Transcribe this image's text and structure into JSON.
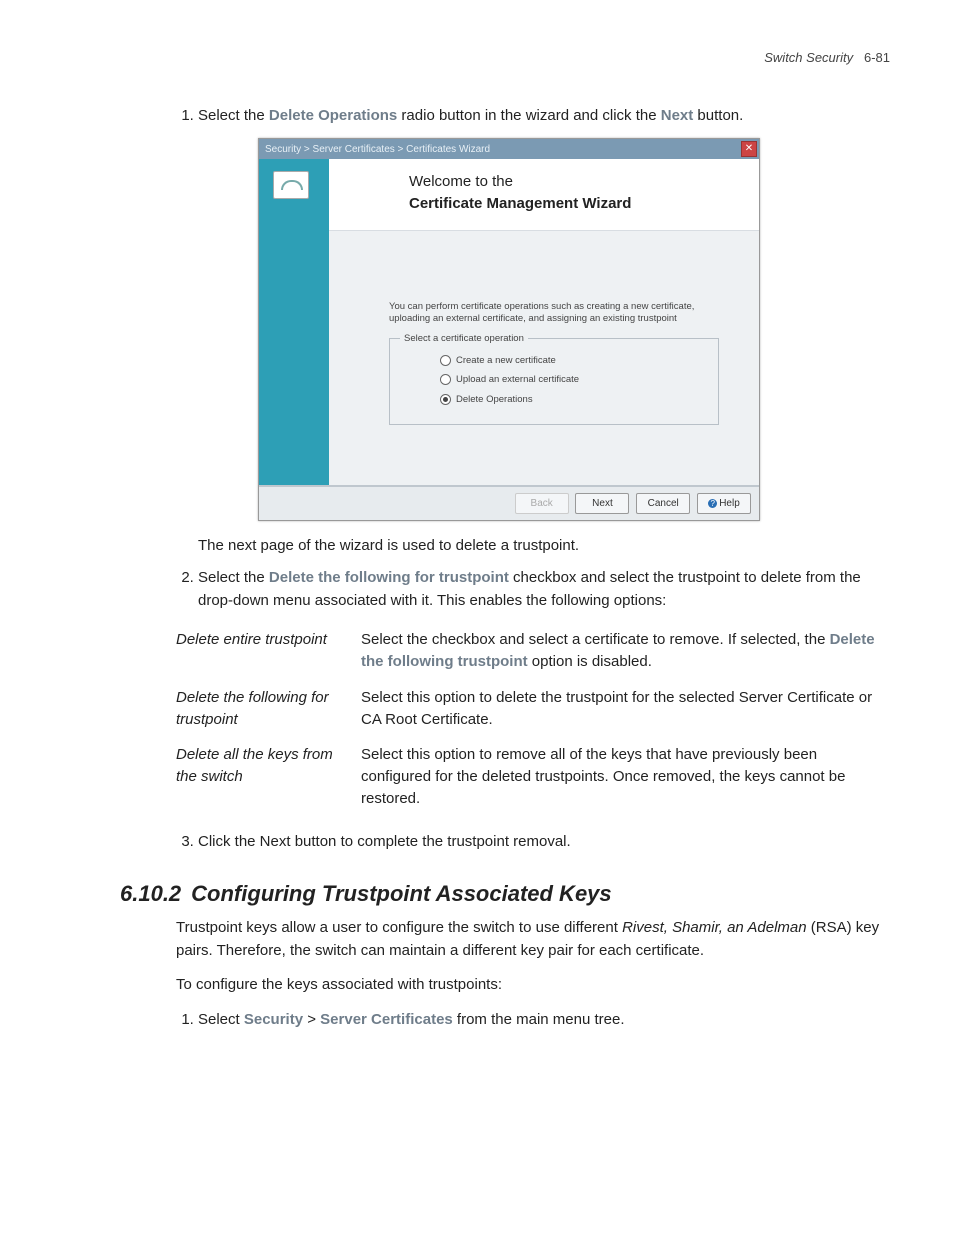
{
  "header": {
    "section": "Switch Security",
    "page": "6-81"
  },
  "step1": {
    "pre": "Select the ",
    "bold1": "Delete Operations",
    "mid": " radio button in the wizard and click the ",
    "bold2": "Next",
    "post": " button."
  },
  "wizard": {
    "titlebar": "Security > Server Certificates > Certificates Wizard",
    "heading_l1": "Welcome to the",
    "heading_l2": "Certificate Management Wizard",
    "desc": "You can perform certificate operations such as creating a new certificate, uploading an external certificate, and assigning an existing trustpoint",
    "legend": "Select a certificate operation",
    "opt1": "Create a new certificate",
    "opt2": "Upload an external certificate",
    "opt3": "Delete Operations",
    "btn_back": "Back",
    "btn_next": "Next",
    "btn_cancel": "Cancel",
    "btn_help": "Help"
  },
  "after_wizard": "The next page of the wizard is used to delete a trustpoint.",
  "step2": {
    "pre": "Select the ",
    "bold": "Delete the following for trustpoint",
    "post": " checkbox and select the trustpoint to delete from the drop-down menu associated with it. This enables the following options:"
  },
  "table": {
    "r1_term": "Delete entire trustpoint",
    "r1_desc_pre": "Select the checkbox and select a certificate to remove. If selected, the ",
    "r1_desc_bold": "Delete the following trustpoint",
    "r1_desc_post": " option is disabled.",
    "r2_term": "Delete the following for trustpoint",
    "r2_desc": "Select this option to delete the trustpoint for the selected Server Certificate or CA Root Certificate.",
    "r3_term": "Delete all the keys from the switch",
    "r3_desc": "Select this option to remove all of the keys that have previously been configured for the deleted trustpoints. Once removed, the keys cannot be restored."
  },
  "step3": "Click the Next button to complete the trustpoint removal.",
  "section": {
    "num": "6.10.2",
    "title": "Configuring Trustpoint Associated Keys",
    "p1_pre": "Trustpoint keys allow a user to configure the switch to use different ",
    "p1_it": "Rivest, Shamir, an Adelman",
    "p1_post": " (RSA) key pairs. Therefore, the switch can maintain a different key pair for each certificate.",
    "p2": "To configure the keys associated with trustpoints:",
    "s1_pre": "Select ",
    "s1_b1": "Security",
    "s1_gt": " > ",
    "s1_b2": "Server Certificates",
    "s1_post": " from the main menu tree."
  }
}
